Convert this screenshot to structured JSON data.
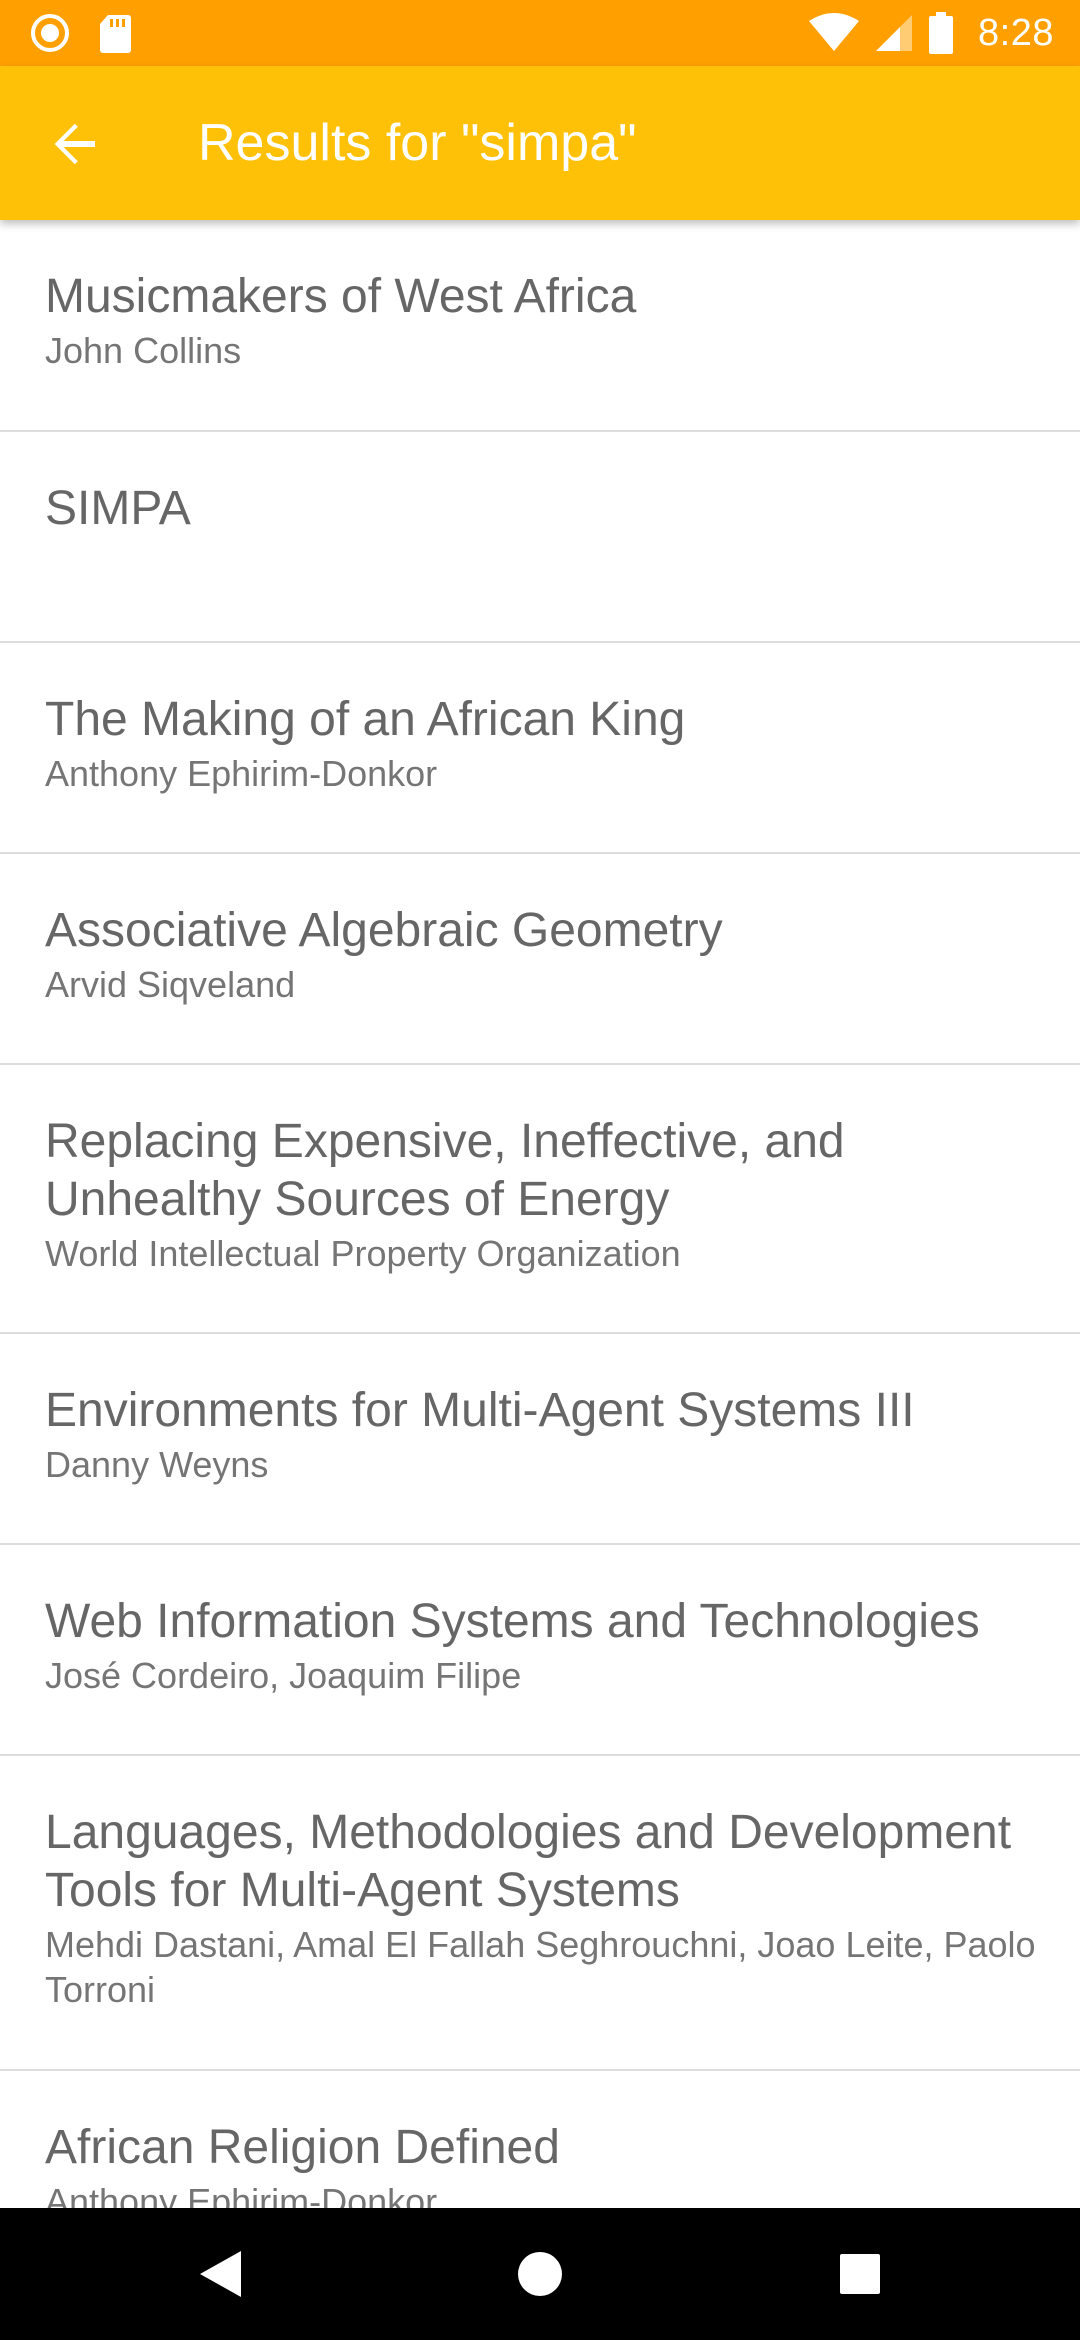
{
  "status_bar": {
    "time": "8:28",
    "icons": [
      "record-icon",
      "sd-card-icon",
      "wifi-icon",
      "cell-signal-icon",
      "battery-icon"
    ]
  },
  "app_bar": {
    "title": "Results for \"simpa\"",
    "back_icon": "arrow-back-icon"
  },
  "results": [
    {
      "title": "Musicmakers of West Africa",
      "author": "John Collins"
    },
    {
      "title": "SIMPA",
      "author": ""
    },
    {
      "title": "The Making of an African King",
      "author": "Anthony Ephirim-Donkor"
    },
    {
      "title": "Associative Algebraic Geometry",
      "author": "Arvid Siqveland"
    },
    {
      "title": "Replacing Expensive, Ineffective, and Unhealthy Sources of Energy",
      "author": "World Intellectual Property Organization"
    },
    {
      "title": "Environments for Multi-Agent Systems III",
      "author": "Danny Weyns"
    },
    {
      "title": "Web Information Systems and Technologies",
      "author": "José Cordeiro, Joaquim Filipe"
    },
    {
      "title": "Languages, Methodologies and Development Tools for Multi-Agent Systems",
      "author": "Mehdi Dastani, Amal El Fallah Seghrouchni, Joao Leite, Paolo Torroni"
    },
    {
      "title": "African Religion Defined",
      "author": "Anthony Ephirim-Donkor"
    }
  ],
  "colors": {
    "status_bar": "#FFA000",
    "app_bar": "#FFC107",
    "title_text": "#666666",
    "author_text": "#757575",
    "divider": "#DDDDDD"
  },
  "nav_bar": {
    "buttons": [
      "back-triangle-icon",
      "home-circle-icon",
      "recents-square-icon"
    ]
  }
}
